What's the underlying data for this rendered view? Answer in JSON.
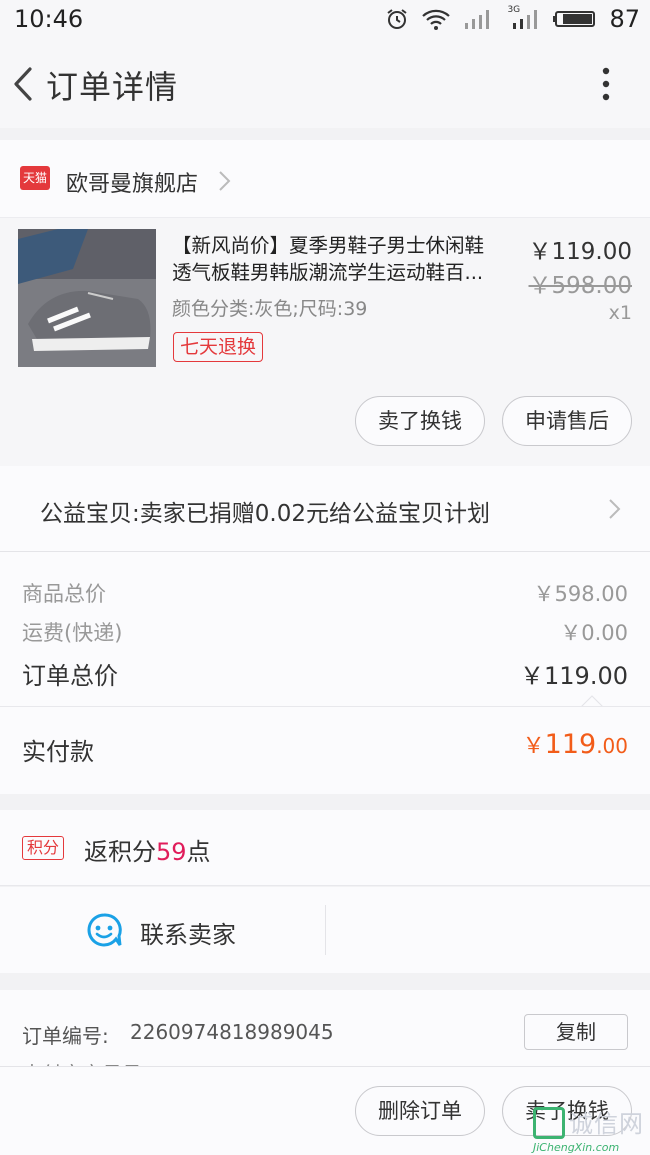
{
  "status_bar": {
    "time": "10:46",
    "battery": "87",
    "network": "3G"
  },
  "nav": {
    "title": "订单详情"
  },
  "shop": {
    "badge": "天猫",
    "name": "欧哥曼旗舰店"
  },
  "item": {
    "title_line1": "【新风尚价】夏季男鞋子男士休闲鞋",
    "title_line2": "透气板鞋男韩版潮流学生运动鞋百...",
    "spec": "颜色分类:灰色;尺码:39",
    "return_tag": "七天退换",
    "price": "￥119.00",
    "original_price": "￥598.00",
    "quantity": "x1",
    "actions": [
      "卖了换钱",
      "申请售后"
    ]
  },
  "charity": {
    "text": "公益宝贝:卖家已捐赠0.02元给公益宝贝计划"
  },
  "totals": {
    "goods_label": "商品总价",
    "goods_value": "￥598.00",
    "shipping_label": "运费(快递)",
    "shipping_value": "￥0.00",
    "order_label": "订单总价",
    "order_value": "￥119.00",
    "paid_label": "实付款",
    "paid_symbol": "￥",
    "paid_int": "119",
    "paid_dec": ".00"
  },
  "points": {
    "badge": "积分",
    "prefix": "返积分",
    "count": "59",
    "suffix": "点"
  },
  "contact": {
    "label": "联系卖家"
  },
  "order": {
    "number_label": "订单编号:",
    "number": "2260974818989045",
    "copy_label": "复制",
    "payment_label": "支付宝交易号:"
  },
  "bottom_bar": {
    "buttons": [
      "删除订单",
      "卖了换钱"
    ]
  },
  "watermark": {
    "cn": "诚信网",
    "en": "JiChengXin.com"
  },
  "colors": {
    "brand_red": "#e4393c",
    "paid_orange": "#f25c19",
    "points_pink": "#e01c5a",
    "chat_blue": "#1aa1e6"
  }
}
